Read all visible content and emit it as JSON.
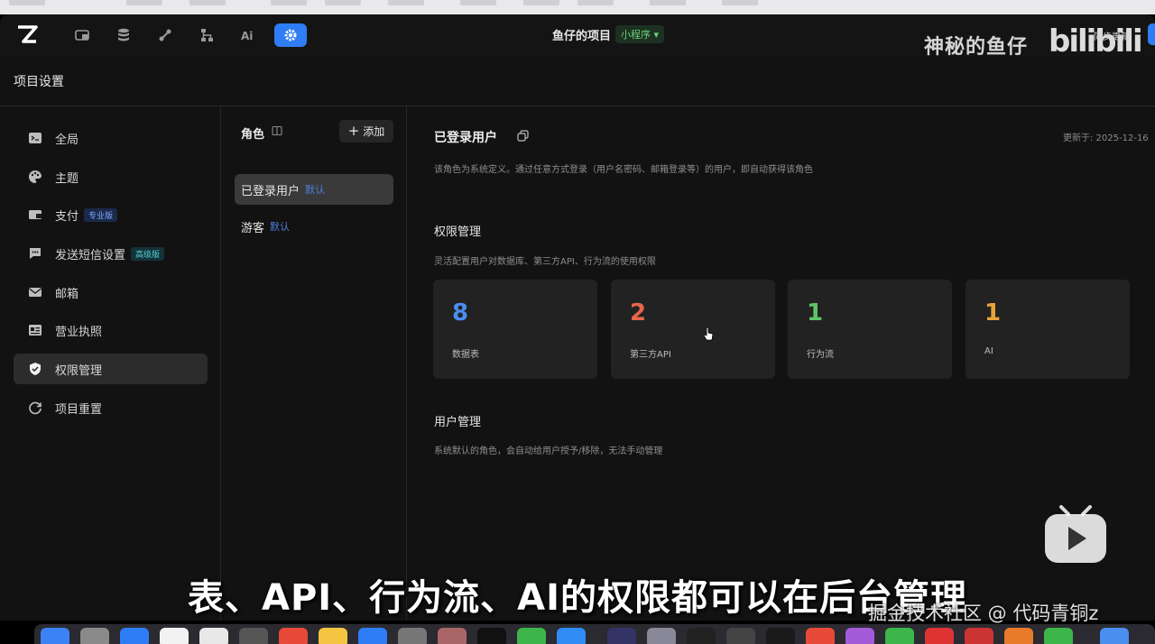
{
  "topnav": {
    "project_title": "鱼仔的项目",
    "project_type": "小程序 ▾",
    "watermark_text": "神秘的鱼仔",
    "watermark_logo": "bilibili",
    "sync_label": "同步更新"
  },
  "header": {
    "title": "项目设置"
  },
  "sidebar": {
    "items": [
      {
        "label": "全局",
        "icon": "terminal-icon"
      },
      {
        "label": "主题",
        "icon": "palette-icon"
      },
      {
        "label": "支付",
        "icon": "card-icon",
        "badge": "专业版"
      },
      {
        "label": "发送短信设置",
        "icon": "message-icon",
        "badge": "高级版"
      },
      {
        "label": "邮箱",
        "icon": "mail-icon"
      },
      {
        "label": "营业执照",
        "icon": "license-icon"
      },
      {
        "label": "权限管理",
        "icon": "shield-icon",
        "active": true
      },
      {
        "label": "项目重置",
        "icon": "reset-icon"
      }
    ]
  },
  "roles": {
    "title": "角色",
    "add_label": "添加",
    "items": [
      {
        "name": "已登录用户",
        "tag": "默认",
        "active": true
      },
      {
        "name": "游客",
        "tag": "默认"
      }
    ]
  },
  "main": {
    "role_title": "已登录用户",
    "updated": "更新于: 2025-12-16",
    "description": "该角色为系统定义。通过任意方式登录（用户名密码、邮箱登录等）的用户，即自动获得该角色",
    "permissions": {
      "title": "权限管理",
      "description": "灵活配置用户对数据库、第三方API、行为流的使用权限",
      "cards": [
        {
          "count": "8",
          "label": "数据表",
          "color": "#4a8ef0"
        },
        {
          "count": "2",
          "label": "第三方API",
          "color": "#e8664a"
        },
        {
          "count": "1",
          "label": "行为流",
          "color": "#5fc36a"
        },
        {
          "count": "1",
          "label": "AI",
          "color": "#e8a23a"
        }
      ]
    },
    "users": {
      "title": "用户管理",
      "description": "系统默认的角色，会自动给用户授予/移除，无法手动管理"
    }
  },
  "video": {
    "subtitle": "表、API、行为流、AI的权限都可以在后台管理",
    "credit": "掘金技术社区 @ 代码青铜z"
  }
}
